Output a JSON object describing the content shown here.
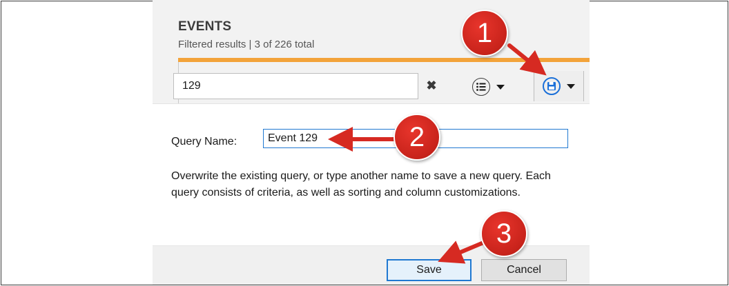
{
  "events": {
    "title": "EVENTS",
    "subtitle": "Filtered results | 3 of 226 total"
  },
  "toolbar": {
    "search_value": "129",
    "clear_glyph": "✖",
    "list_icon": "list-circle-icon",
    "save_icon": "save-disk-icon"
  },
  "dialog": {
    "query_name_label": "Query Name:",
    "query_name_value": "Event 129",
    "description": "Overwrite the existing query, or type another name to save a new query. Each query consists of criteria, as well as sorting and column customizations.",
    "save_label": "Save",
    "cancel_label": "Cancel"
  },
  "annotations": {
    "step1": "1",
    "step2": "2",
    "step3": "3"
  },
  "colors": {
    "accent_orange": "#f3a33a",
    "focus_blue": "#1f78d1",
    "callout_red": "#d62a22"
  }
}
